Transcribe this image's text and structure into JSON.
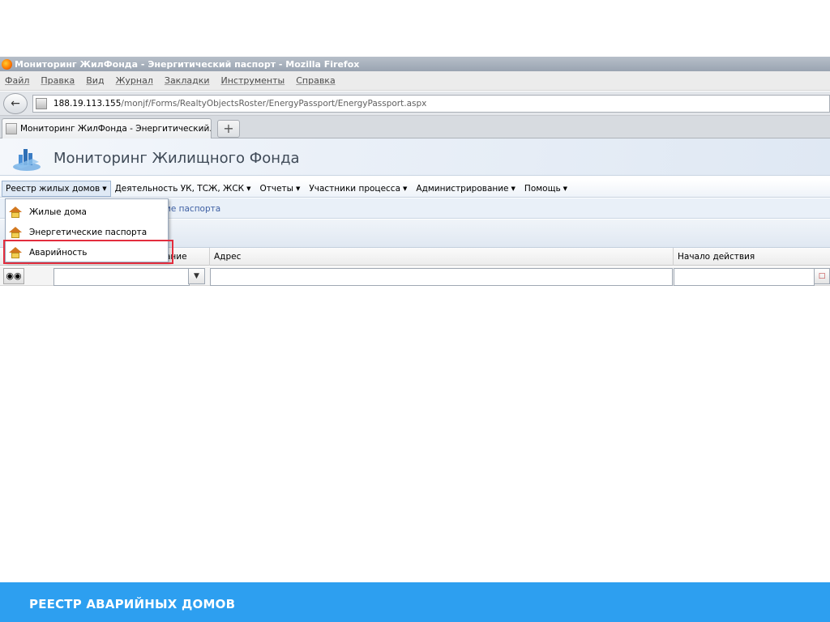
{
  "window": {
    "title": "Мониторинг ЖилФонда - Энергитический паспорт - Mozilla Firefox"
  },
  "menubar": {
    "items": [
      "Файл",
      "Правка",
      "Вид",
      "Журнал",
      "Закладки",
      "Инструменты",
      "Справка"
    ]
  },
  "navbar": {
    "url_host": "188.19.113.155",
    "url_path": "/monjf/Forms/RealtyObjectsRoster/EnergyPassport/EnergyPassport.aspx"
  },
  "tabs": {
    "active_label": "Мониторинг ЖилФонда - Энергитический...",
    "new_tab_label": "+"
  },
  "app": {
    "title": "Мониторинг Жилищного Фонда"
  },
  "mainmenu": {
    "items": [
      "Реестр жилых домов",
      "Деятельность УК, ТСЖ, ЖСК",
      "Отчеты",
      "Участники процесса",
      "Администрирование",
      "Помощь"
    ]
  },
  "breadcrumb": {
    "link": "ие паспорта"
  },
  "dropdown": {
    "items": [
      "Жилые дома",
      "Энергетические паспорта",
      "Аварийность"
    ],
    "highlighted": "Аварийность"
  },
  "grid": {
    "columns": [
      "ание",
      "Адрес",
      "Начало действия"
    ]
  },
  "footer": {
    "title": "РЕЕСТР АВАРИЙНЫХ ДОМОВ"
  },
  "colors": {
    "footer_bg": "#2d9ff0",
    "highlight": "#e32d3d",
    "link": "#3d5fa3"
  },
  "icons": {
    "browser": "firefox-icon",
    "back": "back-arrow-icon",
    "menu_items": "house-icon",
    "filter": "binoculars-icon"
  }
}
